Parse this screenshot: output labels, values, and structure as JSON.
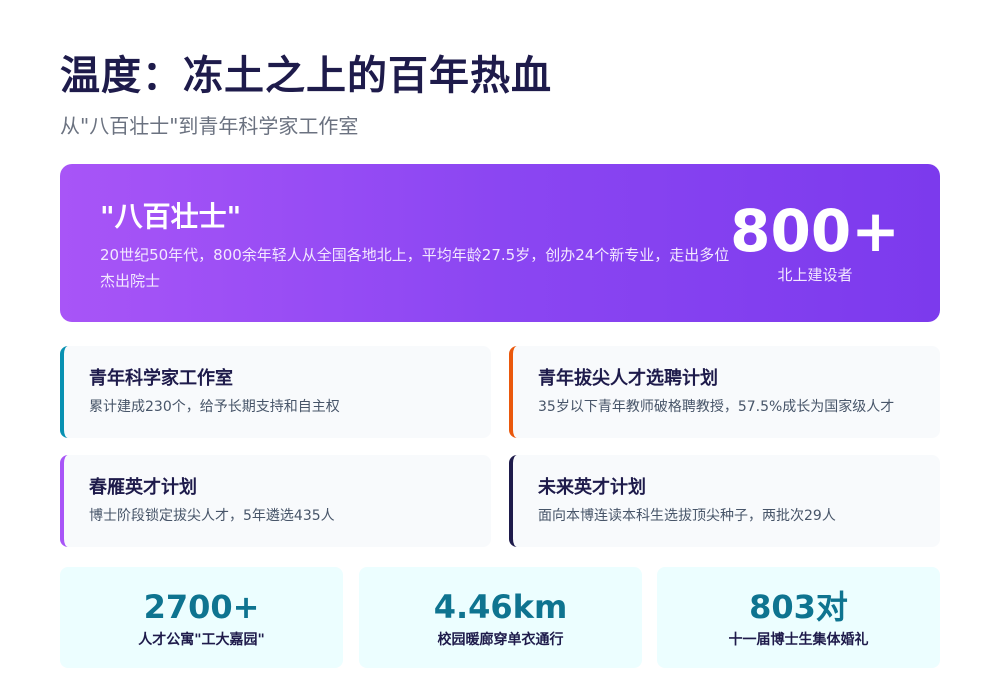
{
  "header": {
    "title": "温度：冻土之上的百年热血",
    "subtitle": "从\"八百壮士\"到青年科学家工作室"
  },
  "hero": {
    "title": "\"八百壮士\"",
    "description": "20世纪50年代，800余年轻人从全国各地北上，平均年龄27.5岁，创办24个新专业，走出多位杰出院士",
    "stat_value": "800+",
    "stat_label": "北上建设者"
  },
  "cards": [
    {
      "title": "青年科学家工作室",
      "description": "累计建成230个，给予长期支持和自主权",
      "accent": "#0891b2"
    },
    {
      "title": "青年拔尖人才选聘计划",
      "description": "35岁以下青年教师破格聘教授，57.5%成长为国家级人才",
      "accent": "#ea580c"
    },
    {
      "title": "春雁英才计划",
      "description": "博士阶段锁定拔尖人才，5年遴选435人",
      "accent": "#a855f7"
    },
    {
      "title": "未来英才计划",
      "description": "面向本博连读本科生选拔顶尖种子，两批次29人",
      "accent": "#1e1b4b"
    }
  ],
  "stats": [
    {
      "value": "2700+",
      "label": "人才公寓\"工大嘉园\""
    },
    {
      "value": "4.46km",
      "label": "校园暖廊穿单衣通行"
    },
    {
      "value": "803对",
      "label": "十一届博士生集体婚礼"
    }
  ],
  "colors": {
    "hero_gradient_start": "#a855f7",
    "hero_gradient_end": "#7c3aed",
    "stat_accent": "#0e7490",
    "stat_background": "#ecfeff"
  }
}
